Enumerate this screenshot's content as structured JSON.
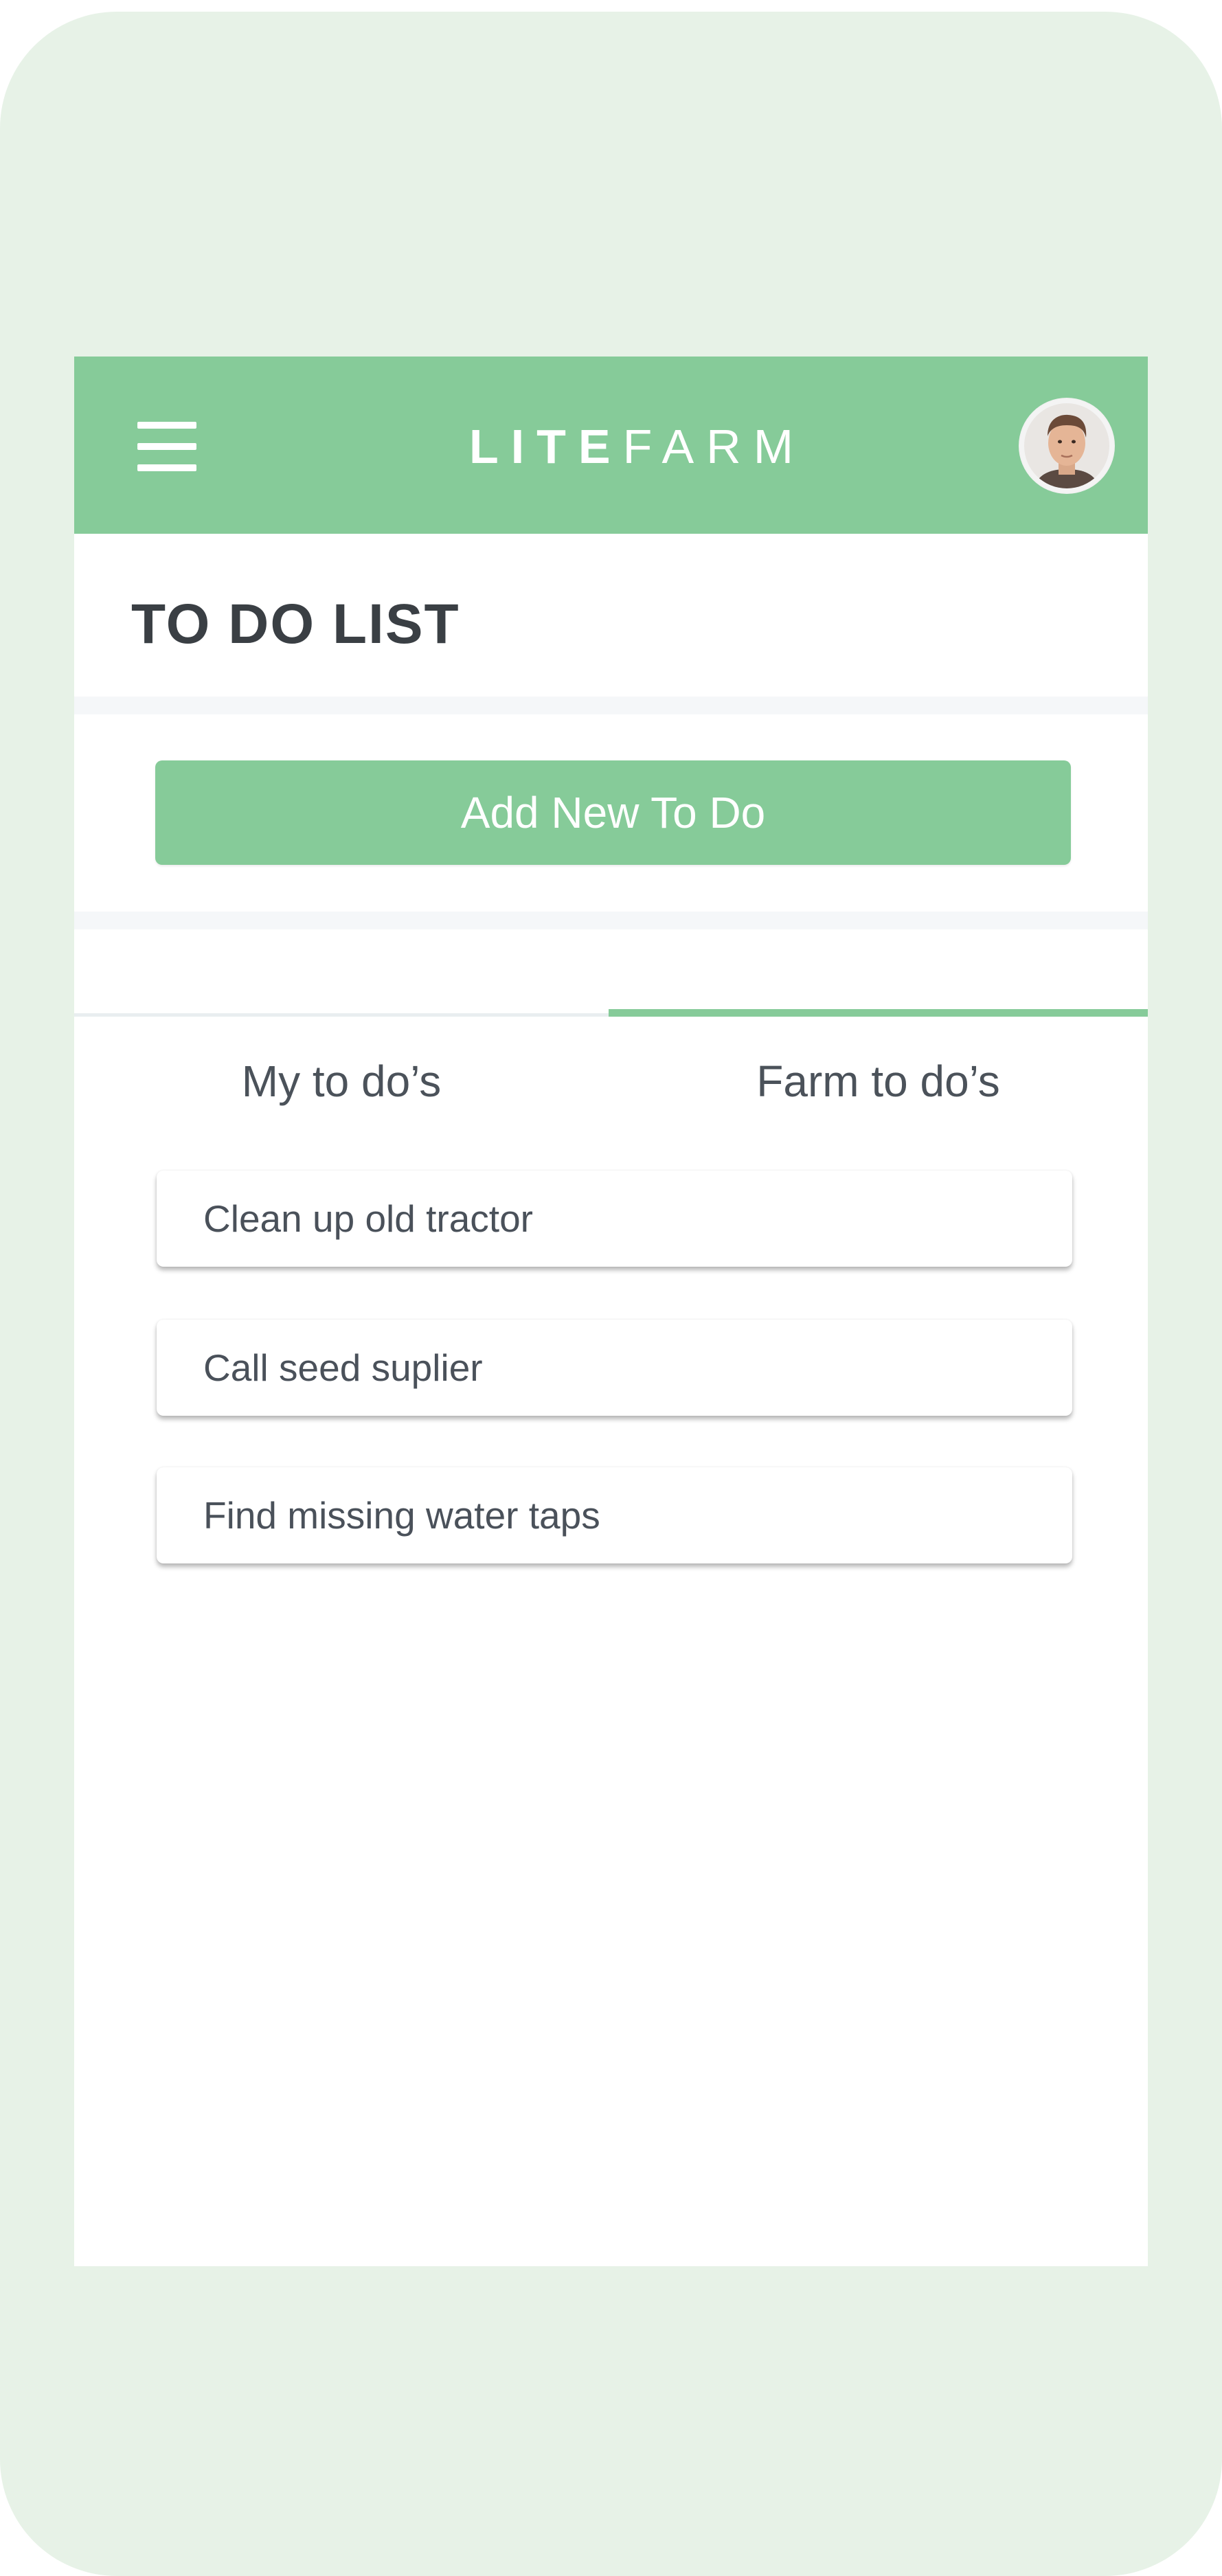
{
  "header": {
    "logo_bold": "LITE",
    "logo_light": "FARM",
    "menu_icon": "hamburger-menu-icon",
    "avatar_icon": "user-avatar"
  },
  "page": {
    "title": "TO DO LIST"
  },
  "actions": {
    "add_label": "Add New To Do"
  },
  "tabs": [
    {
      "label": "My to do’s",
      "active": false
    },
    {
      "label": "Farm to do’s",
      "active": true
    }
  ],
  "todos": [
    {
      "text": "Clean up old tractor"
    },
    {
      "text": "Call seed suplier"
    },
    {
      "text": "Find missing water taps"
    }
  ],
  "colors": {
    "brand_green": "#86cb99",
    "frame_background": "#e7f2e7",
    "text_dark": "#3a3f44"
  }
}
